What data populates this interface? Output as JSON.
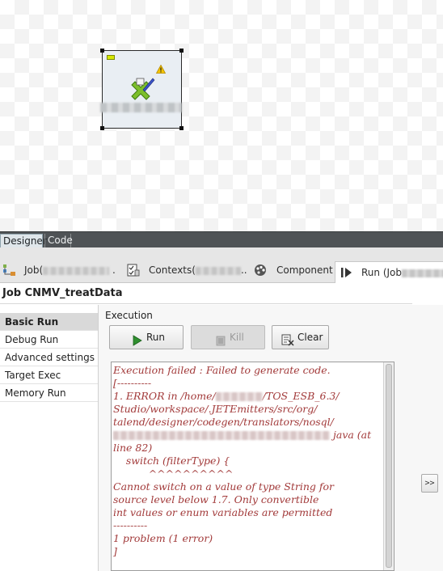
{
  "designer": {
    "component": {
      "name": "component-node",
      "warning_icon": "warning-icon",
      "icon": "mapping-tool-icon"
    }
  },
  "editor_tabs": [
    {
      "label": "Designer",
      "active": true
    },
    {
      "label": "Code",
      "active": false
    }
  ],
  "view_tabs": [
    {
      "label": "Job(",
      "icon": "job-icon"
    },
    {
      "label": "Contexts(",
      "icon": "contexts-icon"
    },
    {
      "label": "Component",
      "icon": "component-palette-icon"
    },
    {
      "label": "Run (Job",
      "icon": "run-view-icon",
      "active": true
    }
  ],
  "job_title": "Job CNMV_treatData",
  "left_nav": {
    "items": [
      "Basic Run",
      "Debug Run",
      "Advanced settings",
      "Target Exec",
      "Memory Run"
    ],
    "active": "Basic Run"
  },
  "execution": {
    "label": "Execution",
    "buttons": {
      "run": "Run",
      "kill": "Kill",
      "clear": "Clear"
    },
    "expand": ">>"
  },
  "console": {
    "line1": "Execution failed : Failed to generate code.",
    "line2": "[----------",
    "line3a": "1. ERROR in /home/",
    "line3b": "/TOS_ESB_6.3/",
    "line4": "Studio/workspace/.JETEmitters/src/org/",
    "line5": "talend/designer/codegen/translators/nosql/",
    "line6b": "java (at",
    "line7": "line 82)",
    "line8": "    switch (filterType) {",
    "line9": "           ^^^^^^^^^^",
    "line10": "Cannot switch on a value of type String for",
    "line11": "source level below 1.7. Only convertible",
    "line12": "int values or enum variables are permitted",
    "line13": "----------",
    "line14": "1 problem (1 error)",
    "line15": "]"
  }
}
